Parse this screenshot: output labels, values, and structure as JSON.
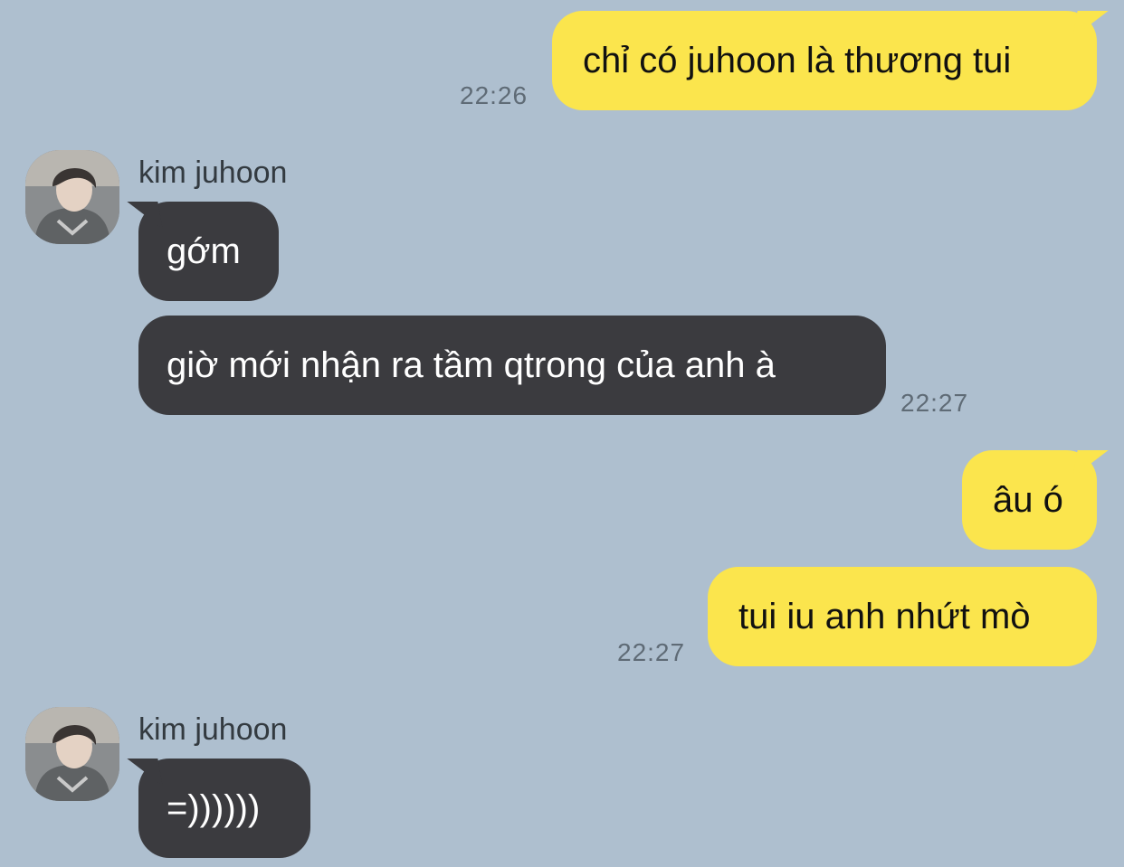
{
  "colors": {
    "background": "#aebfcf",
    "outgoing_bubble": "#fbe54d",
    "incoming_bubble": "#3b3b3f",
    "timestamp": "#5f6b76"
  },
  "messages": [
    {
      "direction": "outgoing",
      "text": "chỉ có juhoon là thương tui",
      "time": "22:26"
    },
    {
      "direction": "incoming",
      "sender": "kim juhoon",
      "text": "gớm"
    },
    {
      "direction": "incoming",
      "text": "giờ mới nhận ra tầm qtrong của anh à",
      "time": "22:27"
    },
    {
      "direction": "outgoing",
      "text": "âu ó"
    },
    {
      "direction": "outgoing",
      "text": "tui iu anh nhứt mò",
      "time": "22:27"
    },
    {
      "direction": "incoming",
      "sender": "kim juhoon",
      "text": "=))))))"
    }
  ],
  "avatar_icon": "profile-photo"
}
